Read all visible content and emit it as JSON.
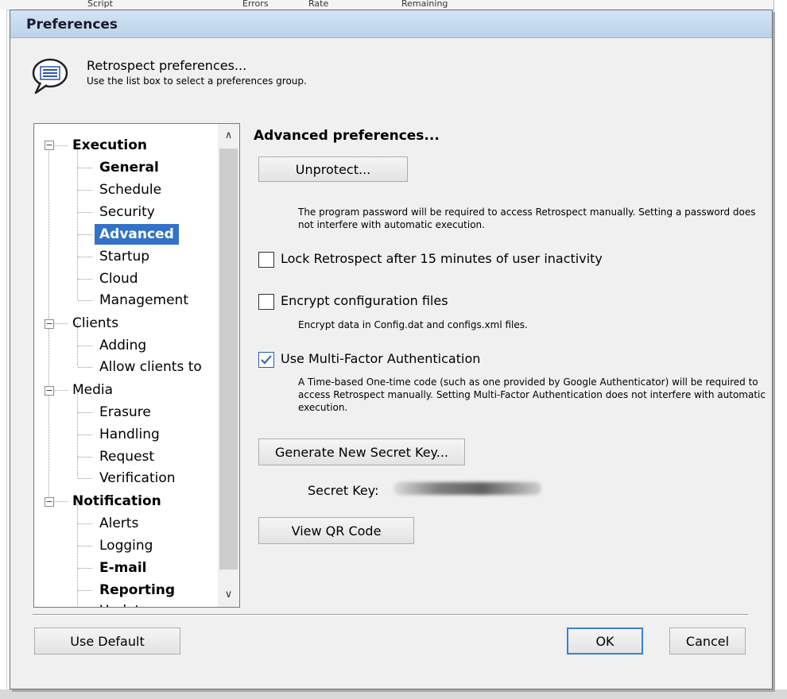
{
  "background": {
    "columns": [
      "Script",
      "Errors",
      "Rate",
      "Remaining"
    ]
  },
  "window": {
    "title": "Preferences"
  },
  "header": {
    "icon": "speech-bubble-icon",
    "title": "Retrospect preferences...",
    "subtitle": "Use the list box to select a preferences group."
  },
  "tree": {
    "groups": [
      {
        "label": "Execution",
        "bold": true,
        "children": [
          "General",
          "Schedule",
          "Security",
          "Advanced",
          "Startup",
          "Cloud",
          "Management"
        ]
      },
      {
        "label": "Clients",
        "bold": false,
        "children": [
          "Adding",
          "Allow clients to"
        ]
      },
      {
        "label": "Media",
        "bold": false,
        "children": [
          "Erasure",
          "Handling",
          "Request",
          "Verification"
        ]
      },
      {
        "label": "Notification",
        "bold": true,
        "children": [
          "Alerts",
          "Logging",
          "E-mail",
          "Reporting",
          "Updates"
        ]
      }
    ],
    "selected": "Advanced",
    "scroll_up_glyph": "∧",
    "scroll_down_glyph": "∨"
  },
  "advanced": {
    "title": "Advanced preferences...",
    "unprotect_button": "Unprotect...",
    "unprotect_desc": "The program password will be required to access Retrospect manually. Setting a password does not interfere with automatic execution.",
    "lock_label": "Lock Retrospect after 15 minutes of user inactivity",
    "lock_checked": false,
    "encrypt_label": "Encrypt configuration files",
    "encrypt_checked": false,
    "encrypt_desc": "Encrypt data in Config.dat and configs.xml files.",
    "mfa_label": "Use Multi-Factor Authentication",
    "mfa_checked": true,
    "mfa_desc": "A Time-based One-time code (such as one provided by Google Authenticator) will be required to access Retrospect manually. Setting Multi-Factor Authentication does not interfere with automatic execution.",
    "generate_button": "Generate New Secret Key...",
    "secret_key_label": "Secret Key:",
    "qr_button": "View QR Code"
  },
  "footer": {
    "default_button": "Use Default",
    "ok_button": "OK",
    "cancel_button": "Cancel"
  },
  "colors": {
    "selection": "#3372c9",
    "titlebar": "#bcd3ea",
    "ok_border": "#3c7fd1"
  }
}
